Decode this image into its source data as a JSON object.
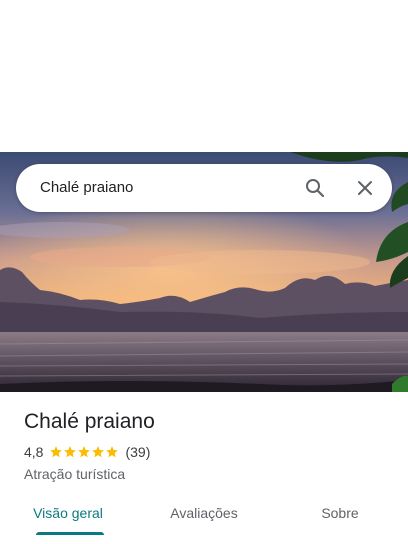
{
  "search": {
    "query": "Chalé praiano"
  },
  "icons": {
    "search": "search-icon",
    "close": "close-icon",
    "star": "star-icon"
  },
  "place": {
    "title": "Chalé praiano",
    "rating_value": "4,8",
    "rating": 4.8,
    "rating_max": 5,
    "review_count": "(39)",
    "category": "Atração turística"
  },
  "tabs": [
    {
      "label": "Visão geral",
      "active": true
    },
    {
      "label": "Avaliações",
      "active": false
    },
    {
      "label": "Sobre",
      "active": false
    }
  ],
  "colors": {
    "accent": "#0b7a80",
    "star": "#fbbc04"
  }
}
